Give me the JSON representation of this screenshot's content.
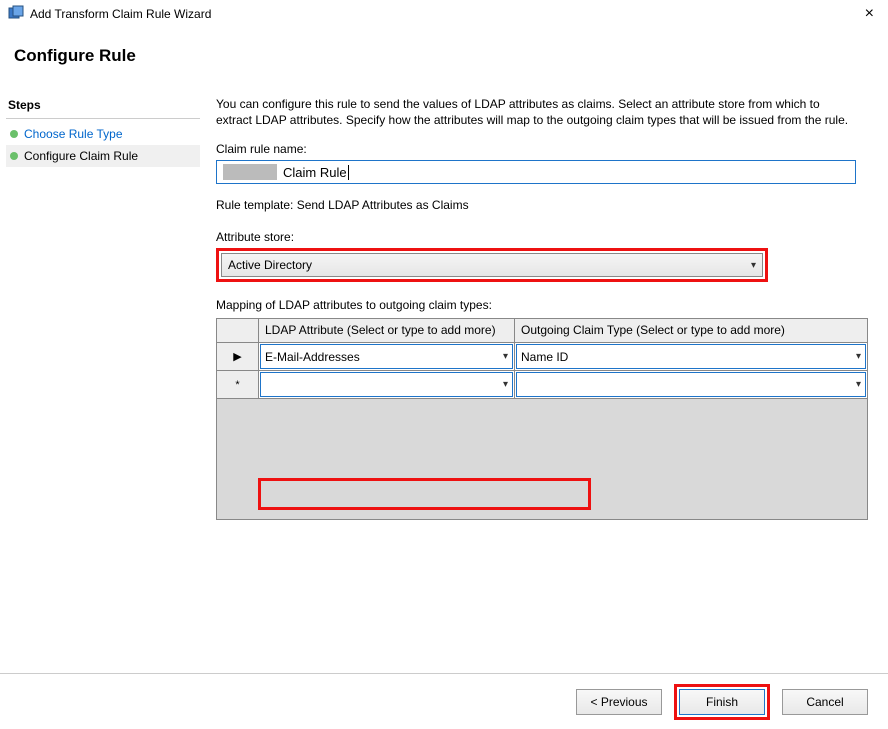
{
  "window": {
    "title": "Add Transform Claim Rule Wizard"
  },
  "header": {
    "title": "Configure Rule"
  },
  "sidebar": {
    "steps_label": "Steps",
    "items": [
      {
        "label": "Choose Rule Type"
      },
      {
        "label": "Configure Claim Rule"
      }
    ]
  },
  "main": {
    "intro": "You can configure this rule to send the values of LDAP attributes as claims. Select an attribute store from which to extract LDAP attributes. Specify how the attributes will map to the outgoing claim types that will be issued from the rule.",
    "name_label": "Claim rule name:",
    "name_value": "Claim Rule",
    "template_line": "Rule template: Send LDAP Attributes as Claims",
    "attr_label": "Attribute store:",
    "attr_value": "Active Directory",
    "map_label": "Mapping of LDAP attributes to outgoing claim types:",
    "grid": {
      "col1": "LDAP Attribute (Select or type to add more)",
      "col2": "Outgoing Claim Type (Select or type to add more)",
      "rows": [
        {
          "marker": "▶",
          "ldap": "E-Mail-Addresses",
          "claim": "Name ID"
        },
        {
          "marker": "*",
          "ldap": "",
          "claim": ""
        }
      ]
    }
  },
  "footer": {
    "previous": "< Previous",
    "finish": "Finish",
    "cancel": "Cancel"
  }
}
